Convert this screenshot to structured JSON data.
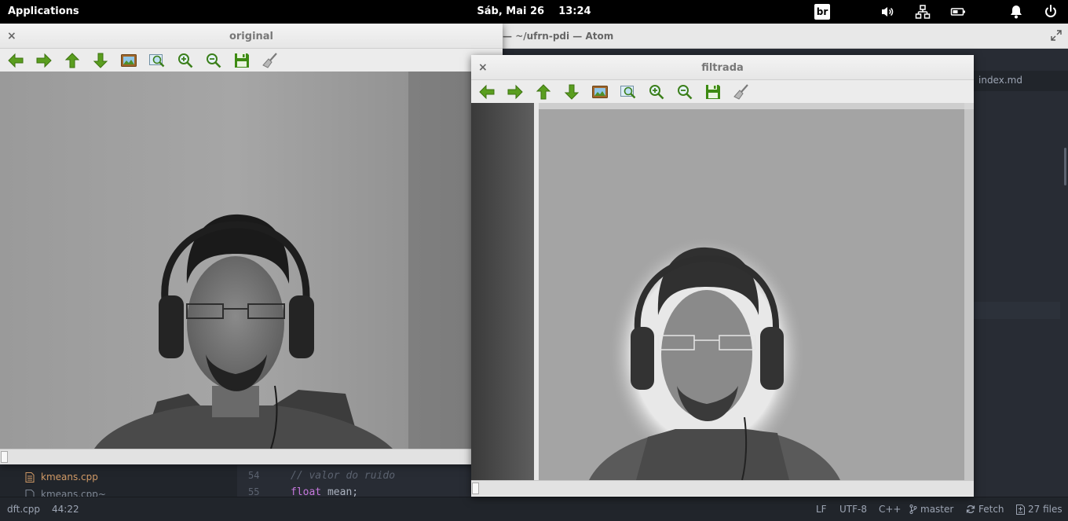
{
  "topbar": {
    "applications": "Applications",
    "date": "Sáb, Mai 26",
    "time": "13:24",
    "keyboard": "br",
    "indicators": [
      "volume-icon",
      "network-icon",
      "battery-icon",
      "notifications-icon",
      "power-icon"
    ]
  },
  "atom": {
    "title": "~/ufrn-pdi — Atom",
    "tab": "index.md",
    "tree": [
      {
        "name": "kmeans.cpp",
        "icon": "file-text-icon"
      },
      {
        "name": "kmeans.cpp~",
        "icon": "file-text-icon"
      }
    ],
    "gutter": [
      "54",
      "55"
    ],
    "code": {
      "line54_comment": "// valor do ruido",
      "line55_keyword": "float",
      "line55_rest": " mean;"
    },
    "status": {
      "file": "dft.cpp",
      "cursor": "44:22",
      "line_ending": "LF",
      "encoding": "UTF-8",
      "grammar": "C++",
      "branch": "master",
      "fetch": "Fetch",
      "files": "27 files"
    }
  },
  "windows": {
    "original": {
      "title": "original",
      "close": "×"
    },
    "filtrada": {
      "title": "filtrada",
      "close": "×"
    }
  },
  "toolbar_icons": [
    "arrow-left-icon",
    "arrow-right-icon",
    "arrow-up-icon",
    "arrow-down-icon",
    "image-icon",
    "zoom-fit-icon",
    "zoom-in-icon",
    "zoom-out-icon",
    "save-icon",
    "clear-icon"
  ],
  "colors": {
    "icon_green": "#5a9e1f",
    "topbar": "#000000",
    "atom_bg": "#282c34"
  }
}
